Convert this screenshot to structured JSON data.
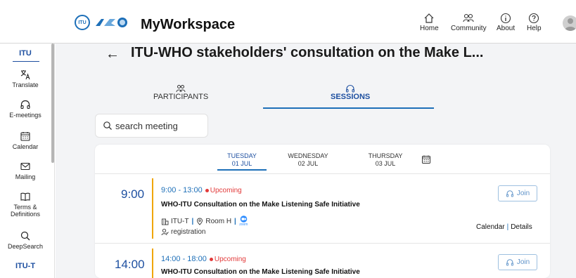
{
  "header": {
    "itu_logo_text": "ITU",
    "app_title": "MyWorkspace",
    "nav": [
      {
        "label": "Home",
        "icon": "home-icon"
      },
      {
        "label": "Community",
        "icon": "community-icon"
      },
      {
        "label": "About",
        "icon": "info-icon"
      },
      {
        "label": "Help",
        "icon": "help-icon"
      }
    ]
  },
  "sidebar": {
    "section_itu": "ITU",
    "items": [
      {
        "label": "Translate",
        "icon": "translate-icon"
      },
      {
        "label": "E-meetings",
        "icon": "headset-icon"
      },
      {
        "label": "Calendar",
        "icon": "calendar-icon"
      },
      {
        "label": "Mailing",
        "icon": "mail-icon"
      },
      {
        "label": "Terms & Definitions",
        "icon": "book-icon"
      },
      {
        "label": "DeepSearch",
        "icon": "search-icon"
      }
    ],
    "section_itut": "ITU-T"
  },
  "main": {
    "back_label": "←",
    "title": "ITU-WHO stakeholders' consultation on the Make L...",
    "tabs": [
      {
        "label": "PARTICIPANTS",
        "icon": "participants-icon"
      },
      {
        "label": "SESSIONS",
        "icon": "headset-icon"
      }
    ],
    "search_placeholder": "search meeting",
    "days": [
      {
        "weekday": "TUESDAY",
        "date": "01 JUL"
      },
      {
        "weekday": "WEDNESDAY",
        "date": "02 JUL"
      },
      {
        "weekday": "THURSDAY",
        "date": "03 JUL"
      }
    ],
    "sessions": [
      {
        "time": "9:00",
        "range": "9:00 - 13:00",
        "status": "Upcoming",
        "title": "WHO-ITU Consultation on the Make Listening Safe Initiative",
        "org": "ITU-T",
        "room": "Room H",
        "zoom": "zoom",
        "registration": "registration",
        "join_label": "Join",
        "calendar_link": "Calendar",
        "details_link": "Details"
      },
      {
        "time": "14:00",
        "range": "14:00 - 18:00",
        "status": "Upcoming",
        "title": "WHO-ITU Consultation on the Make Listening Safe Initiative",
        "join_label": "Join"
      }
    ]
  },
  "colors": {
    "accent": "#1d4fa0",
    "link": "#1d6fb8",
    "upcoming": "#e23a3a",
    "timeline": "#f0a500"
  }
}
